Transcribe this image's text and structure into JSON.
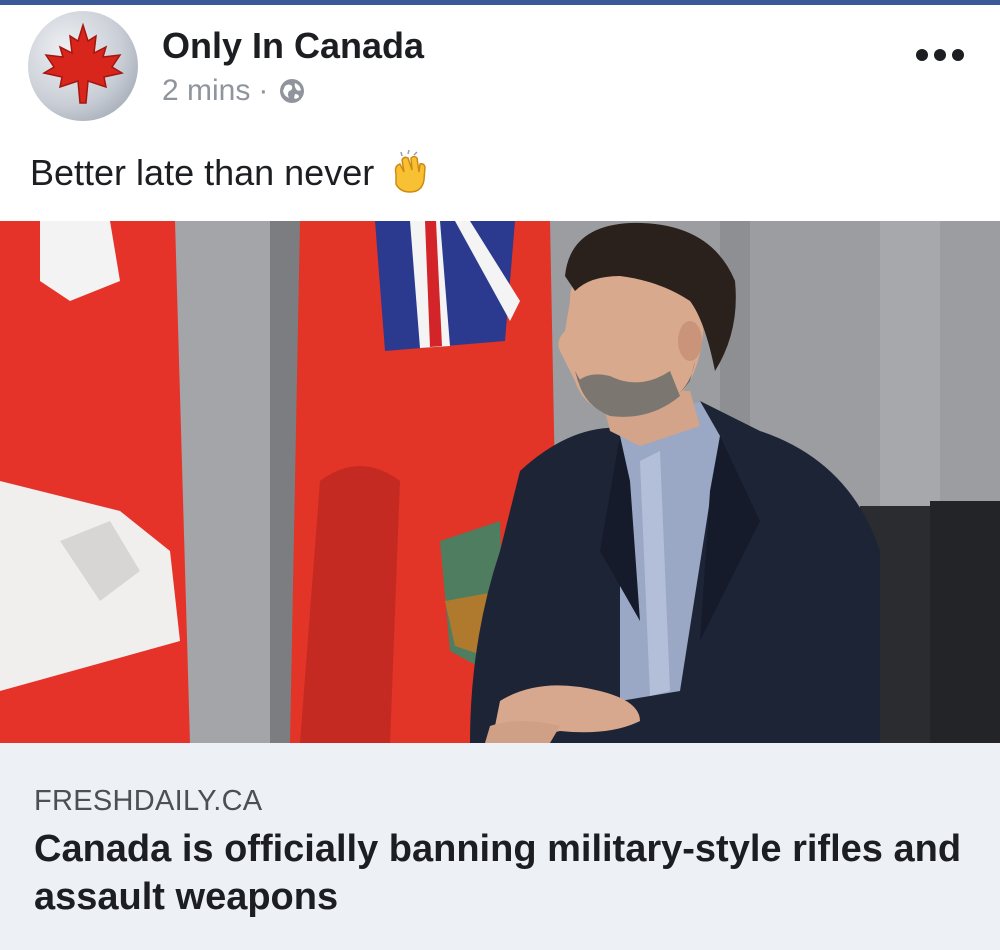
{
  "post": {
    "page_name": "Only In Canada",
    "timestamp": "2 mins",
    "separator": "·",
    "privacy_icon": "globe-icon",
    "more_icon": "more-options-icon",
    "text": "Better late than never",
    "emoji": "clapping-hands-icon"
  },
  "link": {
    "domain": "FRESHDAILY.CA",
    "title": "Canada is officially banning military-style rifles and assault weapons",
    "image": "photo of man in suit seated in front of Canadian and Ontario flags"
  },
  "colors": {
    "accent": "#3b5998",
    "link_preview_bg": "#edf0f4",
    "flag_red": "#e5332a"
  }
}
